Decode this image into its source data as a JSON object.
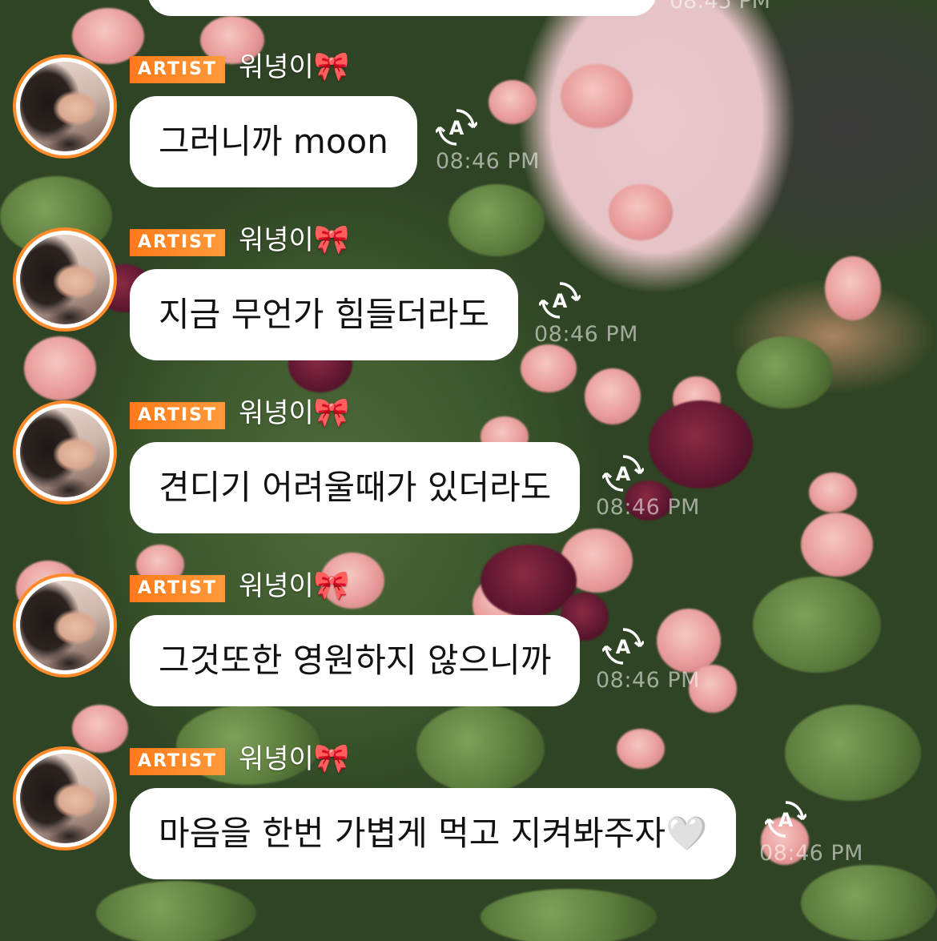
{
  "previous_message": {
    "time": "08:45 PM"
  },
  "messages": [
    {
      "badge": "ARTIST",
      "sender": "워녕이",
      "sender_emoji": "🎀",
      "text": "그러니까 moon",
      "time": "08:46 PM",
      "translate_icon": "translate-icon"
    },
    {
      "badge": "ARTIST",
      "sender": "워녕이",
      "sender_emoji": "🎀",
      "text": "지금 무언가 힘들더라도",
      "time": "08:46 PM",
      "translate_icon": "translate-icon"
    },
    {
      "badge": "ARTIST",
      "sender": "워녕이",
      "sender_emoji": "🎀",
      "text": "견디기 어려울때가 있더라도",
      "time": "08:46 PM",
      "translate_icon": "translate-icon"
    },
    {
      "badge": "ARTIST",
      "sender": "워녕이",
      "sender_emoji": "🎀",
      "text": "그것또한 영원하지 않으니까",
      "time": "08:46 PM",
      "translate_icon": "translate-icon"
    },
    {
      "badge": "ARTIST",
      "sender": "워녕이",
      "sender_emoji": "🎀",
      "text": "마음을 한번 가볍게 먹고 지켜봐주자🤍",
      "time": "08:46 PM",
      "translate_icon": "translate-icon"
    }
  ],
  "colors": {
    "badge_gradient_start": "#ff7a1a",
    "badge_gradient_end": "#ff9a3c",
    "avatar_ring": "#ff8a2a",
    "bubble": "#ffffff",
    "text": "#111111"
  }
}
